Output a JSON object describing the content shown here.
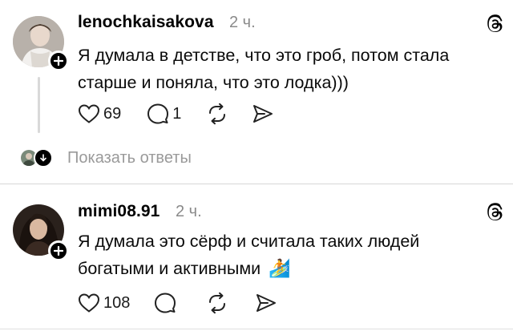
{
  "posts": [
    {
      "username": "lenochkaisakova",
      "time": "2 ч.",
      "text_line1": "Я думала в детстве, что это гроб, потом стала",
      "text_line2": "старше и поняла, что это лодка)))",
      "likes": "69",
      "comments": "1",
      "avatar_icon": "avatar-photo-woman",
      "show_replies": "Показать ответы"
    },
    {
      "username": "mimi08.91",
      "time": "2 ч.",
      "text_line1": "Я думала это сёрф и считала таких людей",
      "text_line2": "богатыми и активными",
      "emoji": "🏄",
      "likes": "108",
      "avatar_icon": "avatar-photo-woman-dark"
    }
  ],
  "icons": [
    "heart-icon",
    "comment-icon",
    "repost-icon",
    "share-icon",
    "threads-logo-icon",
    "plus-icon"
  ]
}
